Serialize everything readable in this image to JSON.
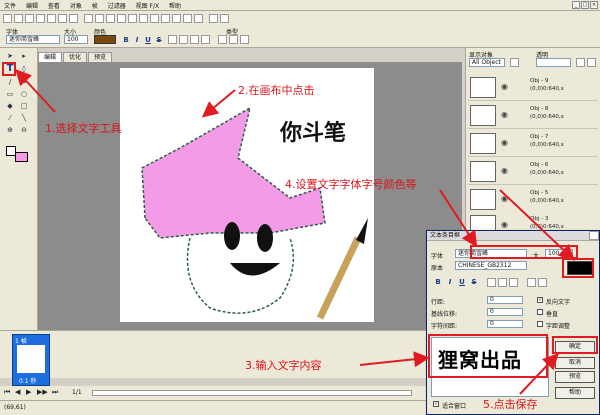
{
  "menu": [
    "文件",
    "编辑",
    "查看",
    "对象",
    "帧",
    "过滤器",
    "视图 F/X",
    "帮助"
  ],
  "toolbar": {
    "font_label": "字体",
    "size_label": "大小",
    "color_label": "颜色",
    "type_label": "类型",
    "font_value": "迷你简雪峰",
    "size_value": "100",
    "btn_bold": "B",
    "btn_italic": "I",
    "btn_underline": "U",
    "btn_strike": "S",
    "text_color": "#7a4a10"
  },
  "tabs": [
    "编辑",
    "优化",
    "预览"
  ],
  "right_panel": {
    "title": "显示对象",
    "trans_label": "透明",
    "dropdown": "All Object",
    "layers": [
      {
        "name": "Obj - 9",
        "info": "(0,0)0:640,x"
      },
      {
        "name": "Obj - 8",
        "info": "(0,0)0:640,x"
      },
      {
        "name": "Obj - 7",
        "info": "(0,0)0:640,x"
      },
      {
        "name": "Obj - 6",
        "info": "(0,0)0:640,x"
      },
      {
        "name": "Obj - 5",
        "info": "(0,0)0:640,x"
      },
      {
        "name": "Obj - 3",
        "info": "(0,0)0:640,x"
      }
    ]
  },
  "canvas": {
    "handwriting": "你斗笔"
  },
  "timeline": {
    "frame_label": "1 帧",
    "frame_time": "0.1 秒",
    "page": "1/1"
  },
  "status": {
    "coords": "(69,61)"
  },
  "dialog": {
    "title": "文本条目框",
    "font_label": "字体",
    "font_value": "迷你简雪峰",
    "size_label": "大",
    "size_value": "100",
    "charset_label": "原本",
    "charset_value": "CHINESE_GB2312",
    "line_label": "行距:",
    "baseline_label": "基线位移:",
    "spacing_label": "字符间距:",
    "line_val": "0",
    "baseline_val": "0",
    "spacing_val": "0",
    "antialias_label": "反向文字",
    "vertical_label": "垂直",
    "kerning_label": "字距调整",
    "preview_text": "狸窝出品",
    "ok": "确定",
    "cancel": "取消",
    "preview": "预览",
    "help": "帮助",
    "fit_label": "适合窗口",
    "color": "#000000"
  },
  "annotations": {
    "a1": "1.选择文字工具",
    "a2": "2.在画布中点击",
    "a3": "3.输入文字内容",
    "a4": "4.设置文字字体字号颜色等",
    "a5": "5.点击保存"
  },
  "colors": {
    "accent": "#e01b22",
    "hat": "#f49be8",
    "frame": "#1d6fe0"
  }
}
